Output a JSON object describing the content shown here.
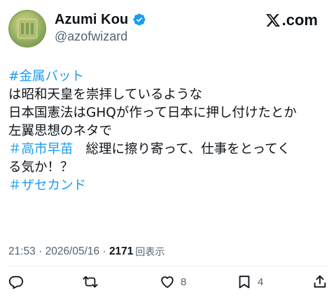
{
  "author": {
    "display_name": "Azumi Kou",
    "handle": "@azofwizard",
    "verified": true
  },
  "brand": {
    "text": ".com",
    "icon": "x-logo-icon"
  },
  "tweet": {
    "lines": [
      {
        "hashtag": "#金属バット"
      },
      {
        "text": "は昭和天皇を崇拝しているような"
      },
      {
        "text": "日本国憲法はGHQが作って日本に押し付けたとか"
      },
      {
        "text": "左翼思想のネタで"
      },
      {
        "hashtag": "＃高市早苗",
        "text": "総理に擦り寄って、仕事をとってく"
      },
      {
        "text": "る気か！？"
      },
      {
        "hashtag": "＃ザセカンド"
      }
    ]
  },
  "meta": {
    "time": "21:53",
    "sep1": " · ",
    "date": "2026/05/16",
    "sep2": " · ",
    "views_count": "2171",
    "views_label": "回表示"
  },
  "actions": {
    "reply": {
      "icon": "reply-icon"
    },
    "repost": {
      "icon": "repost-icon"
    },
    "like": {
      "icon": "heart-icon",
      "count": "8"
    },
    "bookmark": {
      "icon": "bookmark-icon",
      "count": "4"
    },
    "share": {
      "icon": "share-icon"
    }
  },
  "colors": {
    "hashtag": "#1d9bf0",
    "verified": "#1d9bf0",
    "text": "#0f1419",
    "secondary": "#536471"
  }
}
